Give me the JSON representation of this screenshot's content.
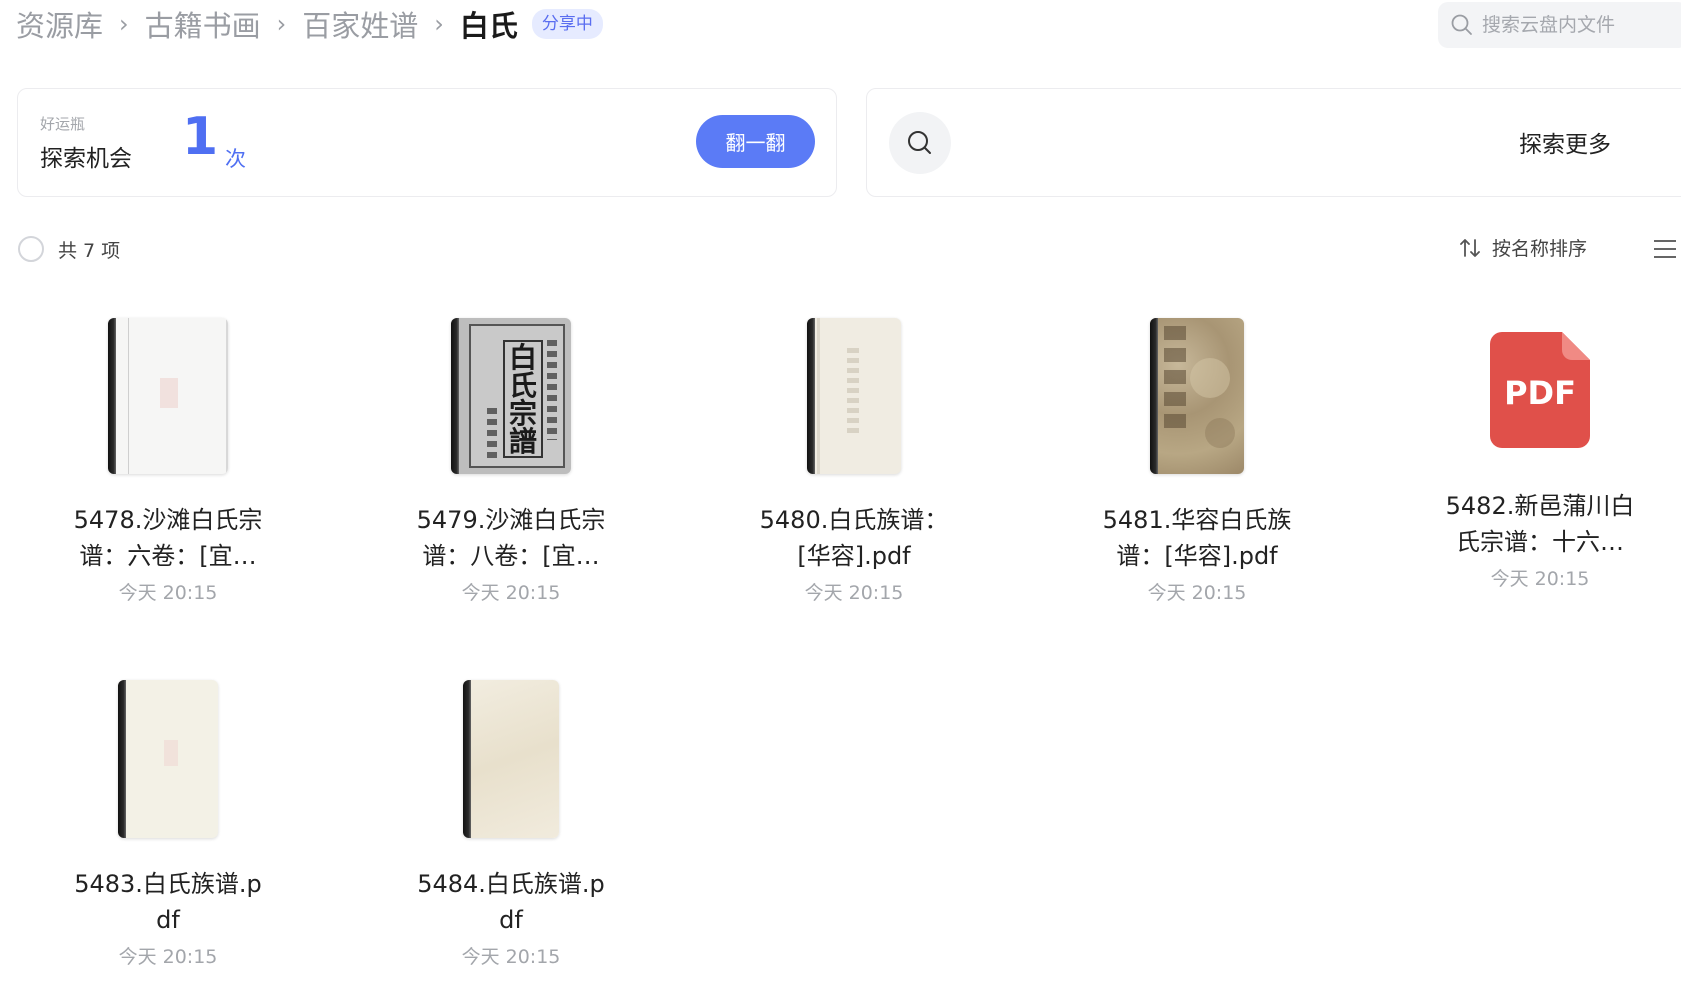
{
  "breadcrumb": {
    "items": [
      "资源库",
      "古籍书画",
      "百家姓谱"
    ],
    "separator": "›",
    "current": "白氏",
    "badge": "分享中"
  },
  "search": {
    "placeholder": "搜索云盘内文件"
  },
  "luck_card": {
    "caption": "好运瓶",
    "title": "探索机会",
    "count": "1",
    "unit": "次",
    "button_label": "翻一翻"
  },
  "explore_card": {
    "label": "探索更多"
  },
  "toolbar": {
    "count_label": "共 7 项",
    "sort_label": "按名称排序"
  },
  "colors": {
    "accent": "#5b7bf6",
    "pdf_red": "#e0504a"
  },
  "files": [
    {
      "name": "5478.沙滩白氏宗谱：六卷：[宜…",
      "time": "今天 20:15",
      "thumb": "book-scan-white"
    },
    {
      "name": "5479.沙滩白氏宗谱：八卷：[宜…",
      "time": "今天 20:15",
      "thumb": "book-scan-title"
    },
    {
      "name": "5480.白氏族谱：[华容].pdf",
      "time": "今天 20:15",
      "thumb": "book-scan-cream"
    },
    {
      "name": "5481.华容白氏族谱：[华容].pdf",
      "time": "今天 20:15",
      "thumb": "book-scan-brown"
    },
    {
      "name": "5482.新邑蒲川白氏宗谱：十六…",
      "time": "今天 20:15",
      "thumb": "pdf-icon",
      "pdf_label": "PDF"
    },
    {
      "name": "5483.白氏族谱.pdf",
      "time": "今天 20:15",
      "thumb": "book-scan-pale"
    },
    {
      "name": "5484.白氏族谱.pdf",
      "time": "今天 20:15",
      "thumb": "book-scan-beige"
    }
  ],
  "thumb_title_chars": "白氏宗譜"
}
